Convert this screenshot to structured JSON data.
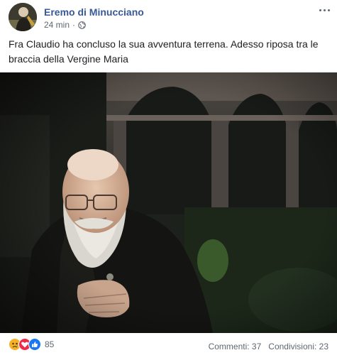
{
  "post": {
    "author": "Eremo di Minucciano",
    "time": "24 min",
    "separator": "·",
    "privacy_icon": "globe-icon",
    "menu_icon": "more-options-icon",
    "message": "Fra Claudio ha concluso la sua avventura terrena. Adesso riposa tra le braccia della Vergine Maria"
  },
  "reactions": {
    "icons": [
      "sad-reaction-icon",
      "love-reaction-icon",
      "like-reaction-icon"
    ],
    "count": "85",
    "comments": "Commenti: 37",
    "shares": "Condivisioni: 23"
  },
  "colors": {
    "author_link": "#385898",
    "meta_text": "#616770",
    "sad": "#f7b125",
    "love": "#f0284a",
    "like": "#1877f2"
  }
}
